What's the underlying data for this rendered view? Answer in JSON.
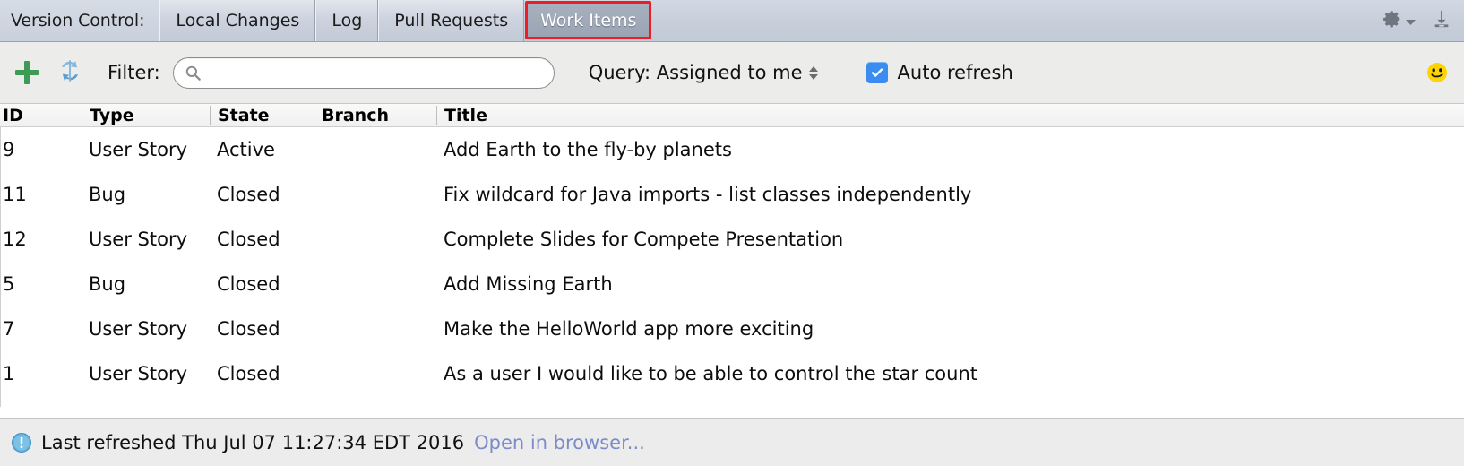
{
  "tabbar": {
    "vc_label": "Version Control:",
    "tabs": [
      {
        "label": "Local Changes",
        "selected": false
      },
      {
        "label": "Log",
        "selected": false
      },
      {
        "label": "Pull Requests",
        "selected": false
      },
      {
        "label": "Work Items",
        "selected": true
      }
    ],
    "settings_icon": "gear-icon",
    "settings_chevron": "chevron-down-icon",
    "hide_icon": "hide-panel-icon",
    "selected_tab_highlight_color": "#ee1c25",
    "selected_tab_bg": "#9ba4b4"
  },
  "toolbar": {
    "add_icon": "plus-icon",
    "add_icon_color": "#3d9b55",
    "refresh_icon": "refresh-icon",
    "refresh_icon_color": "#7aaedb",
    "filter_label": "Filter:",
    "search": {
      "icon": "search-icon",
      "value": "",
      "placeholder": ""
    },
    "query": {
      "label": "Query: Assigned to me",
      "stepper_icon": "up-down-stepper-icon"
    },
    "auto_refresh": {
      "label": "Auto refresh",
      "checked": true,
      "check_color": "#3b8cf0"
    },
    "smiley_icon": "smiley-face-icon",
    "smiley_color": "#ffd400"
  },
  "table": {
    "columns": [
      "ID",
      "Type",
      "State",
      "Branch",
      "Title"
    ],
    "rows": [
      {
        "id": "9",
        "type": "User Story",
        "state": "Active",
        "branch": "",
        "title": "Add Earth to the fly-by planets"
      },
      {
        "id": "11",
        "type": "Bug",
        "state": "Closed",
        "branch": "",
        "title": "Fix wildcard for Java imports - list classes independently"
      },
      {
        "id": "12",
        "type": "User Story",
        "state": "Closed",
        "branch": "",
        "title": "Complete Slides for Compete Presentation"
      },
      {
        "id": "5",
        "type": "Bug",
        "state": "Closed",
        "branch": "",
        "title": "Add Missing Earth"
      },
      {
        "id": "7",
        "type": "User Story",
        "state": "Closed",
        "branch": "",
        "title": "Make the HelloWorld app more exciting"
      },
      {
        "id": "1",
        "type": "User Story",
        "state": "Closed",
        "branch": "",
        "title": "As a user I would like to be able to control the star count"
      }
    ]
  },
  "statusbar": {
    "icon": "info-icon",
    "icon_color": "#4ba3d8",
    "text": "Last refreshed Thu Jul 07 11:27:34 EDT 2016",
    "link": "Open in browser...",
    "link_color": "#7b8cc8"
  }
}
